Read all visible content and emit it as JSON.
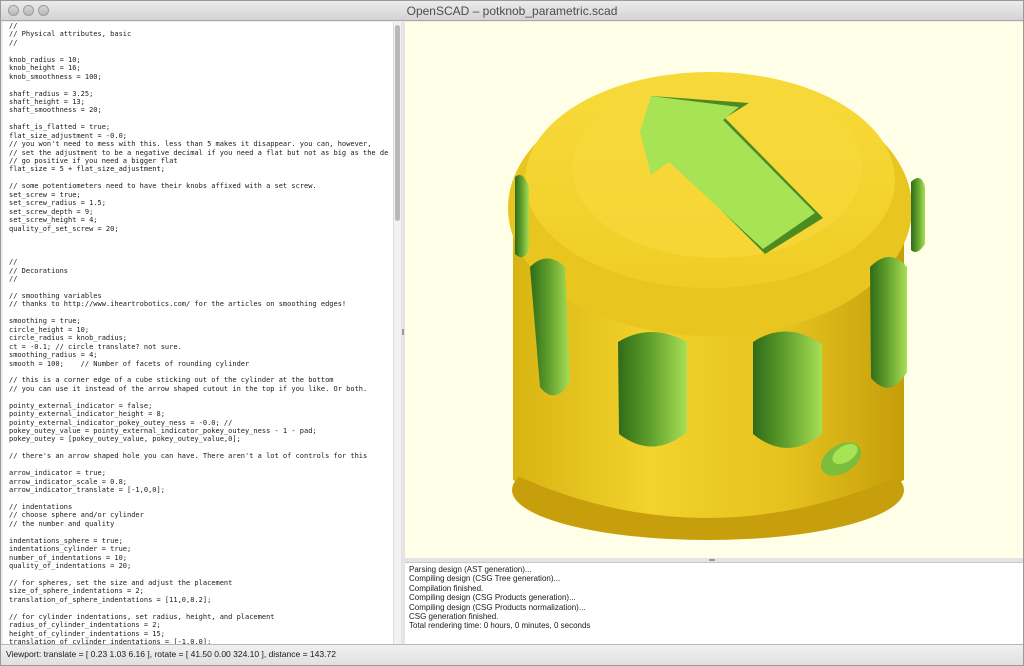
{
  "window": {
    "title": "OpenSCAD – potknob_parametric.scad"
  },
  "editor": {
    "lines": [
      "//",
      "// Physical attributes, basic",
      "//",
      "",
      "knob_radius = 10;",
      "knob_height = 16;",
      "knob_smoothness = 100;",
      "",
      "shaft_radius = 3.25;",
      "shaft_height = 13;",
      "shaft_smoothness = 20;",
      "",
      "shaft_is_flatted = true;",
      "flat_size_adjustment = -0.0;",
      "// you won't need to mess with this. less than 5 makes it disappear. you can, however,",
      "// set the adjustment to be a negative decimal if you need a flat but not as big as the default.",
      "// go positive if you need a bigger flat",
      "flat_size = 5 + flat_size_adjustment;",
      "",
      "// some potentiometers need to have their knobs affixed with a set screw.",
      "set_screw = true;",
      "set_screw_radius = 1.5;",
      "set_screw_depth = 9;",
      "set_screw_height = 4;",
      "quality_of_set_screw = 20;",
      "",
      "",
      "",
      "//",
      "// Decorations",
      "//",
      "",
      "// smoothing variables",
      "// thanks to http://www.iheartrobotics.com/ for the articles on smoothing edges!",
      "",
      "smoothing = true;",
      "circle_height = 10;",
      "circle_radius = knob_radius;",
      "ct = -0.1; // circle translate? not sure.",
      "smoothing_radius = 4;",
      "smooth = 100;    // Number of facets of rounding cylinder",
      "",
      "// this is a corner edge of a cube sticking out of the cylinder at the bottom",
      "// you can use it instead of the arrow shaped cutout in the top if you like. Or both.",
      "",
      "pointy_external_indicator = false;",
      "pointy_external_indicator_height = 8;",
      "pointy_external_indicator_pokey_outey_ness = -0.0; //",
      "pokey_outey_value = pointy_external_indicator_pokey_outey_ness - 1 - pad;",
      "pokey_outey = [pokey_outey_value, pokey_outey_value,0];",
      "",
      "// there's an arrow shaped hole you can have. There aren't a lot of controls for this",
      "",
      "arrow_indicator = true;",
      "arrow_indicator_scale = 0.8;",
      "arrow_indicator_translate = [-1,0,0];",
      "",
      "// indentations",
      "// choose sphere and/or cylinder",
      "// the number and quality",
      "",
      "indentations_sphere = true;",
      "indentations_cylinder = true;",
      "number_of_indentations = 10;",
      "quality_of_indentations = 20;",
      "",
      "// for spheres, set the size and adjust the placement",
      "size_of_sphere_indentations = 2;",
      "translation_of_sphere_indentations = [11,0,8.2];",
      "",
      "// for cylinder indentations, set radius, height, and placement",
      "radius_of_cylinder_indentations = 2;",
      "height_of_cylinder_indentations = 15;",
      "translation_of_cylinder_indentations = [-1,0,0];"
    ]
  },
  "console": {
    "messages": [
      "Parsing design (AST generation)...",
      "Compiling design (CSG Tree generation)...",
      "Compilation finished.",
      "Compiling design (CSG Products generation)...",
      "Compiling design (CSG Products normalization)...",
      "CSG generation finished.",
      "Total rendering time: 0 hours, 0 minutes, 0 seconds"
    ]
  },
  "statusbar": {
    "text": "Viewport: translate = [ 0.23 1.03 6.16 ], rotate = [ 41.50 0.00 324.10 ], distance = 143.72"
  },
  "colors": {
    "viewport_background": "#ffffe7",
    "model_yellow": "#f5d72e",
    "model_dark_yellow": "#cfa70d",
    "cutout_green": "#a8e255",
    "cutout_dark_green": "#3f7d1f"
  },
  "icons": {
    "close": "close-button-icon",
    "minimize": "minimize-button-icon",
    "zoom": "zoom-button-icon"
  }
}
